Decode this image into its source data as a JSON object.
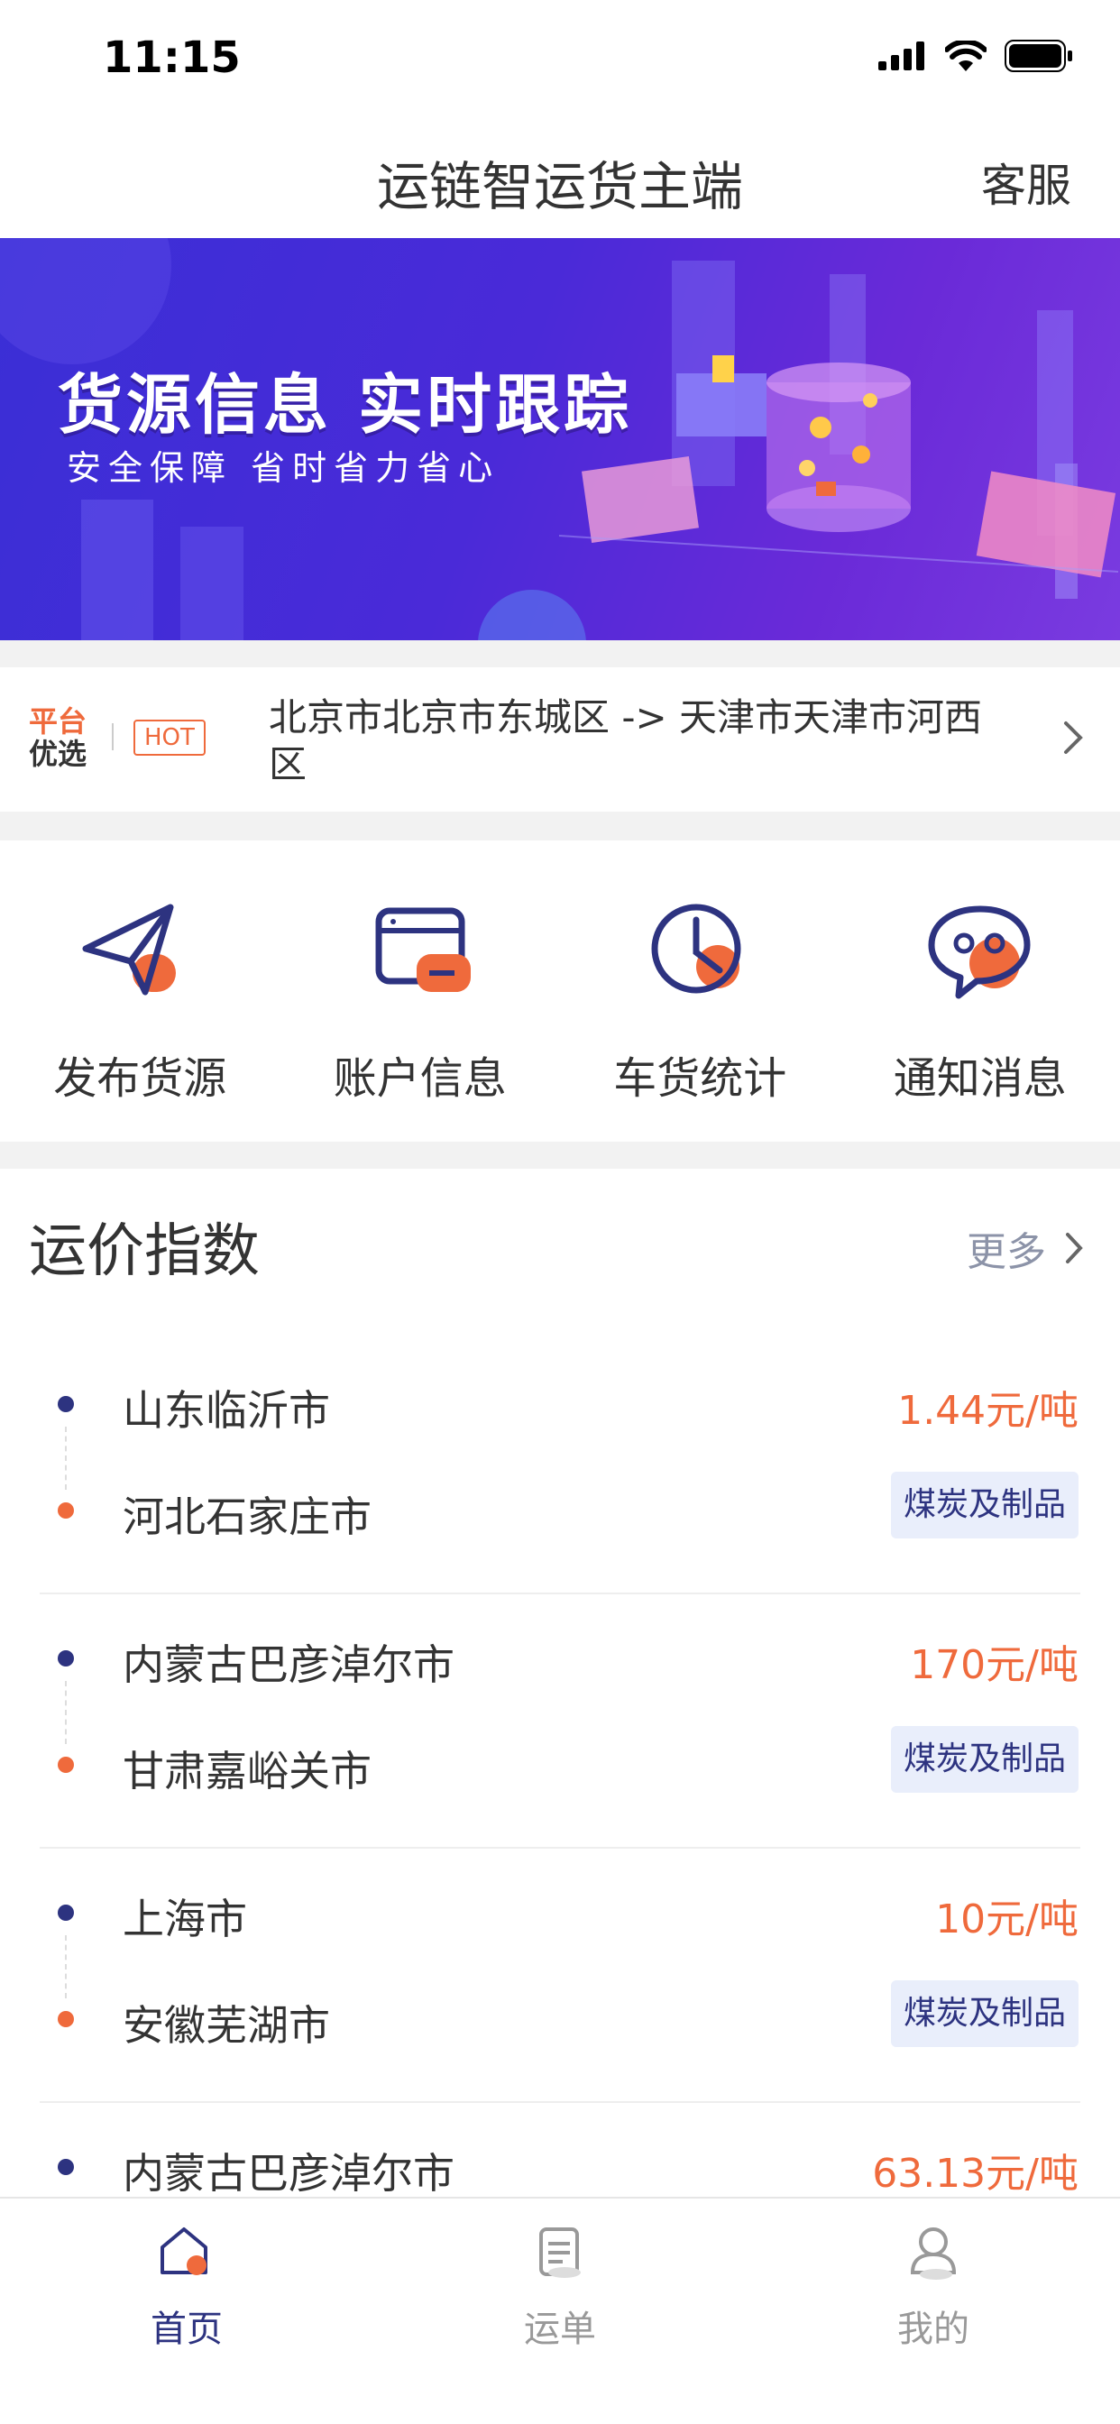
{
  "status_bar": {
    "time": "11:15"
  },
  "nav": {
    "title": "运链智运货主端",
    "service": "客服"
  },
  "banner": {
    "title": "货源信息  实时跟踪",
    "subtitle": "安全保障  省时省力省心"
  },
  "hot": {
    "badge_line1": "平台",
    "badge_line2": "优选",
    "tag": "HOT",
    "route": "北京市北京市东城区 -> 天津市天津市河西区"
  },
  "quick_actions": [
    {
      "label": "发布货源",
      "icon": "paper-plane-icon"
    },
    {
      "label": "账户信息",
      "icon": "card-icon"
    },
    {
      "label": "车货统计",
      "icon": "clock-icon"
    },
    {
      "label": "通知消息",
      "icon": "chat-bubble-icon"
    }
  ],
  "freight_index": {
    "title": "运价指数",
    "more": "更多",
    "routes": [
      {
        "from": "山东临沂市",
        "to": "河北石家庄市",
        "price": "1.44元/吨",
        "cargo": "煤炭及制品"
      },
      {
        "from": "内蒙古巴彦淖尔市",
        "to": "甘肃嘉峪关市",
        "price": "170元/吨",
        "cargo": "煤炭及制品"
      },
      {
        "from": "上海市",
        "to": "安徽芜湖市",
        "price": "10元/吨",
        "cargo": "煤炭及制品"
      },
      {
        "from": "内蒙古巴彦淖尔市",
        "to": "",
        "price": "63.13元/吨",
        "cargo": ""
      }
    ]
  },
  "tabbar": [
    {
      "label": "首页",
      "icon": "home-icon",
      "active": true
    },
    {
      "label": "运单",
      "icon": "waybill-icon",
      "active": false
    },
    {
      "label": "我的",
      "icon": "profile-icon",
      "active": false
    }
  ],
  "colors": {
    "primary": "#2d3380",
    "accent": "#ef6a3c",
    "banner": "#4a2ad8"
  }
}
